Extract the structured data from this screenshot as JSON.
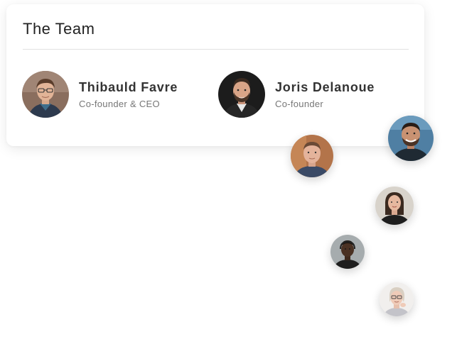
{
  "team": {
    "title": "The Team",
    "members": [
      {
        "name": "Thibauld Favre",
        "role": "Co-founder & CEO"
      },
      {
        "name": "Joris Delanoue",
        "role": "Co-founder"
      }
    ]
  },
  "floating_avatars": [
    "avatar-photo-1",
    "avatar-photo-2",
    "avatar-photo-3",
    "avatar-photo-4",
    "avatar-photo-5"
  ]
}
